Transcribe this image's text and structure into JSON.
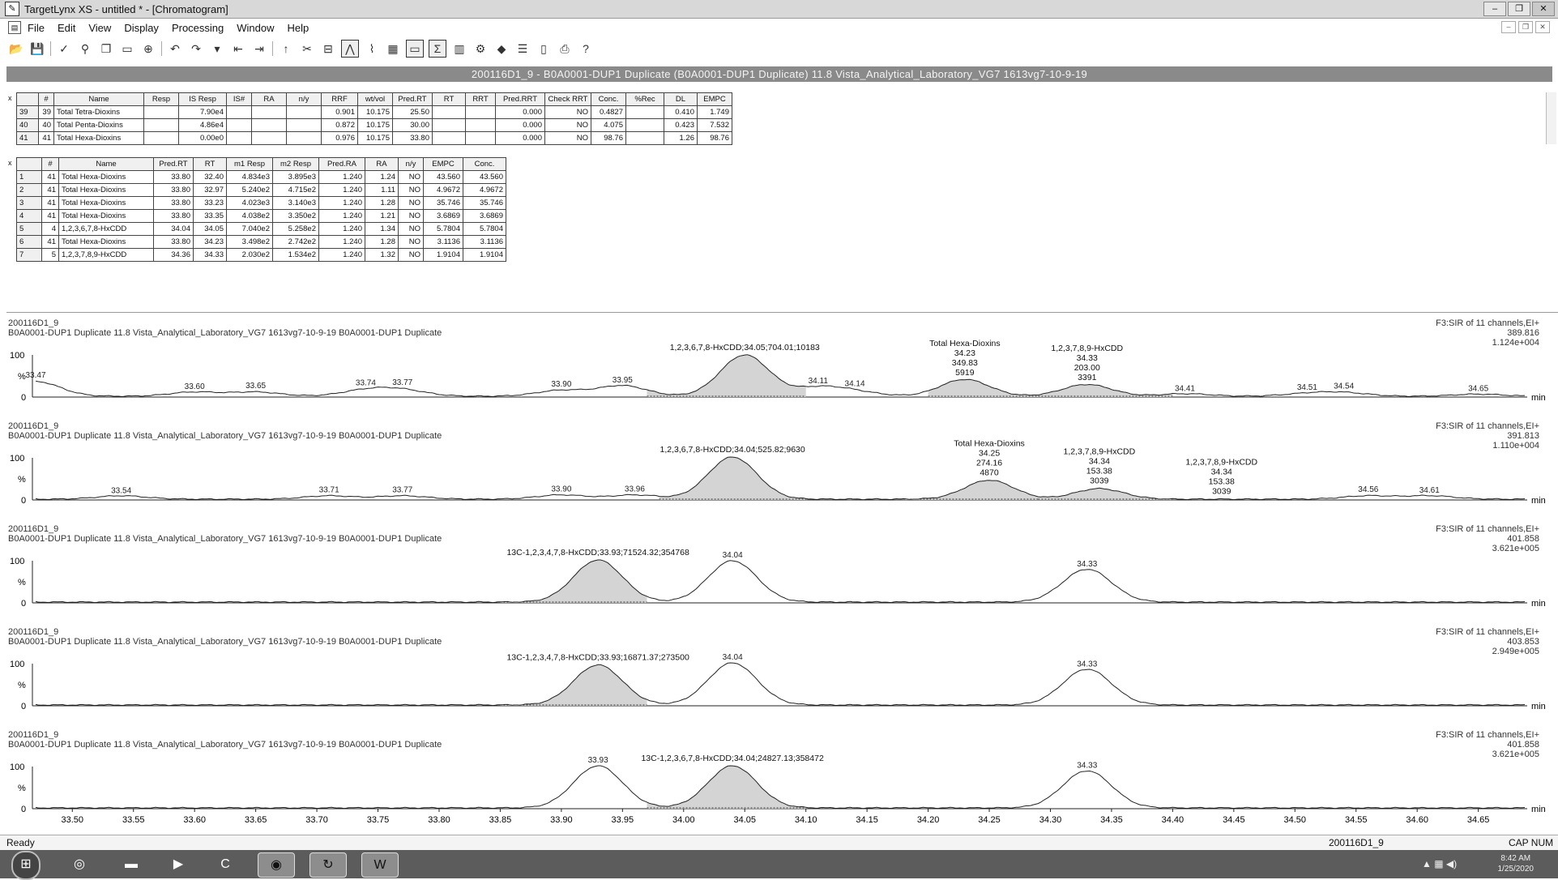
{
  "window": {
    "title": "TargetLynx XS - untitled * - [Chromatogram]"
  },
  "menu": [
    "File",
    "Edit",
    "View",
    "Display",
    "Processing",
    "Window",
    "Help"
  ],
  "databar": "200116D1_9 - B0A0001-DUP1 Duplicate (B0A0001-DUP1 Duplicate) 11.8 Vista_Analytical_Laboratory_VG7 1613vg7-10-9-19",
  "table1": {
    "corner": "x",
    "headers": [
      "#",
      "Name",
      "Resp",
      "IS Resp",
      "IS#",
      "RA",
      "n/y",
      "RRF",
      "wt/vol",
      "Pred.RT",
      "RT",
      "RRT",
      "Pred.RRT",
      "Check RRT",
      "Conc.",
      "%Rec",
      "DL",
      "EMPC"
    ],
    "rows": [
      [
        "39",
        "39",
        "Total Tetra-Dioxins",
        "",
        "7.90e4",
        "",
        "",
        "",
        "0.901",
        "10.175",
        "25.50",
        "",
        "",
        "0.000",
        "NO",
        "0.4827",
        "",
        "0.410",
        "1.749"
      ],
      [
        "40",
        "40",
        "Total Penta-Dioxins",
        "",
        "4.86e4",
        "",
        "",
        "",
        "0.872",
        "10.175",
        "30.00",
        "",
        "",
        "0.000",
        "NO",
        "4.075",
        "",
        "0.423",
        "7.532"
      ],
      [
        "41",
        "41",
        "Total Hexa-Dioxins",
        "",
        "0.00e0",
        "",
        "",
        "",
        "0.976",
        "10.175",
        "33.80",
        "",
        "",
        "0.000",
        "NO",
        "98.76",
        "",
        "1.26",
        "98.76"
      ]
    ]
  },
  "table2": {
    "corner": "x",
    "headers": [
      "#",
      "Name",
      "Pred.RT",
      "RT",
      "m1 Resp",
      "m2 Resp",
      "Pred.RA",
      "RA",
      "n/y",
      "EMPC",
      "Conc."
    ],
    "rows": [
      [
        "1",
        "41",
        "Total Hexa-Dioxins",
        "33.80",
        "32.40",
        "4.834e3",
        "3.895e3",
        "1.240",
        "1.24",
        "NO",
        "43.560",
        "43.560"
      ],
      [
        "2",
        "41",
        "Total Hexa-Dioxins",
        "33.80",
        "32.97",
        "5.240e2",
        "4.715e2",
        "1.240",
        "1.11",
        "NO",
        "4.9672",
        "4.9672"
      ],
      [
        "3",
        "41",
        "Total Hexa-Dioxins",
        "33.80",
        "33.23",
        "4.023e3",
        "3.140e3",
        "1.240",
        "1.28",
        "NO",
        "35.746",
        "35.746"
      ],
      [
        "4",
        "41",
        "Total Hexa-Dioxins",
        "33.80",
        "33.35",
        "4.038e2",
        "3.350e2",
        "1.240",
        "1.21",
        "NO",
        "3.6869",
        "3.6869"
      ],
      [
        "5",
        "4",
        "1,2,3,6,7,8-HxCDD",
        "34.04",
        "34.05",
        "7.040e2",
        "5.258e2",
        "1.240",
        "1.34",
        "NO",
        "5.7804",
        "5.7804"
      ],
      [
        "6",
        "41",
        "Total Hexa-Dioxins",
        "33.80",
        "34.23",
        "3.498e2",
        "2.742e2",
        "1.240",
        "1.28",
        "NO",
        "3.1136",
        "3.1136"
      ],
      [
        "7",
        "5",
        "1,2,3,7,8,9-HxCDD",
        "34.36",
        "34.33",
        "2.030e2",
        "1.534e2",
        "1.240",
        "1.32",
        "NO",
        "1.9104",
        "1.9104"
      ]
    ]
  },
  "panels": [
    {
      "sample": "200116D1_9",
      "desc": "B0A0001-DUP1 Duplicate 11.8 Vista_Analytical_Laboratory_VG7 1613vg7-10-9-19 B0A0001-DUP1 Duplicate",
      "func": "F3:SIR of 11 channels,EI+",
      "mass": "389.816",
      "intensity": "1.124e+004",
      "peaks": [
        [
          33.47,
          0.35
        ],
        [
          33.6,
          0.1
        ],
        [
          33.65,
          0.1
        ],
        [
          33.74,
          0.14
        ],
        [
          33.77,
          0.14
        ],
        [
          33.9,
          0.14
        ],
        [
          33.95,
          0.25
        ],
        [
          34.05,
          0.98
        ],
        [
          34.11,
          0.2
        ],
        [
          34.14,
          0.1
        ],
        [
          34.23,
          0.4
        ],
        [
          34.33,
          0.28
        ],
        [
          34.41,
          0.06
        ],
        [
          34.51,
          0.06
        ],
        [
          34.54,
          0.08
        ],
        [
          34.65,
          0.05
        ]
      ],
      "rt_labels": [
        "33.47",
        "33.60",
        "33.65",
        "33.74",
        "33.77",
        "33.90",
        "33.95",
        "34.11",
        "34.14",
        "34.41",
        "34.51",
        "34.54",
        "34.65"
      ],
      "annotations": [
        {
          "x": 34.05,
          "lines": [
            "1,2,3,6,7,8-HxCDD;34.05;704.01;10183"
          ]
        },
        {
          "x": 34.23,
          "lines": [
            "Total Hexa-Dioxins",
            "34.23",
            "349.83",
            "5919"
          ]
        },
        {
          "x": 34.33,
          "lines": [
            "1,2,3,7,8,9-HxCDD",
            "34.33",
            "203.00",
            "3391"
          ]
        }
      ],
      "shaded": [
        [
          33.97,
          34.1
        ],
        [
          34.2,
          34.29
        ],
        [
          34.29,
          34.4
        ]
      ]
    },
    {
      "sample": "200116D1_9",
      "desc": "B0A0001-DUP1 Duplicate 11.8 Vista_Analytical_Laboratory_VG7 1613vg7-10-9-19 B0A0001-DUP1 Duplicate",
      "func": "F3:SIR of 11 channels,EI+",
      "mass": "391.813",
      "intensity": "1.110e+004",
      "peaks": [
        [
          33.54,
          0.08
        ],
        [
          33.71,
          0.08
        ],
        [
          33.77,
          0.08
        ],
        [
          33.9,
          0.1
        ],
        [
          33.96,
          0.1
        ],
        [
          34.04,
          1.0
        ],
        [
          34.25,
          0.45
        ],
        [
          34.34,
          0.25
        ],
        [
          34.56,
          0.08
        ],
        [
          34.61,
          0.08
        ]
      ],
      "rt_labels": [
        "33.54",
        "33.71",
        "33.77",
        "33.90",
        "33.96",
        "34.56",
        "34.61"
      ],
      "annotations": [
        {
          "x": 34.04,
          "lines": [
            "1,2,3,6,7,8-HxCDD;34.04;525.82;9630"
          ]
        },
        {
          "x": 34.25,
          "lines": [
            "Total Hexa-Dioxins",
            "34.25",
            "274.16",
            "4870"
          ]
        },
        {
          "x": 34.34,
          "lines": [
            "1,2,3,7,8,9-HxCDD",
            "34.34",
            "153.38",
            "3039"
          ]
        },
        {
          "x": 34.44,
          "lines": [
            "1,2,3,7,8,9-HxCDD",
            "34.34",
            "153.38",
            "3039"
          ]
        }
      ],
      "shaded": [
        [
          33.98,
          34.1
        ],
        [
          34.18,
          34.29
        ],
        [
          34.29,
          34.4
        ]
      ]
    },
    {
      "sample": "200116D1_9",
      "desc": "B0A0001-DUP1 Duplicate 11.8 Vista_Analytical_Laboratory_VG7 1613vg7-10-9-19 B0A0001-DUP1 Duplicate",
      "func": "F3:SIR of 11 channels,EI+",
      "mass": "401.858",
      "intensity": "3.621e+005",
      "peaks": [
        [
          33.93,
          1.0
        ],
        [
          34.04,
          0.98
        ],
        [
          34.33,
          0.78
        ]
      ],
      "rt_labels": [
        "34.04",
        "34.33"
      ],
      "annotations": [
        {
          "x": 33.93,
          "lines": [
            "13C-1,2,3,4,7,8-HxCDD;33.93;71524.32;354768"
          ]
        }
      ],
      "shaded": [
        [
          33.85,
          33.97
        ]
      ]
    },
    {
      "sample": "200116D1_9",
      "desc": "B0A0001-DUP1 Duplicate 11.8 Vista_Analytical_Laboratory_VG7 1613vg7-10-9-19 B0A0001-DUP1 Duplicate",
      "func": "F3:SIR of 11 channels,EI+",
      "mass": "403.853",
      "intensity": "2.949e+005",
      "peaks": [
        [
          33.93,
          0.95
        ],
        [
          34.04,
          1.0
        ],
        [
          34.33,
          0.85
        ]
      ],
      "rt_labels": [
        "34.04",
        "34.33"
      ],
      "annotations": [
        {
          "x": 33.93,
          "lines": [
            "13C-1,2,3,4,7,8-HxCDD;33.93;16871.37;273500"
          ]
        }
      ],
      "shaded": [
        [
          33.85,
          33.97
        ]
      ]
    },
    {
      "sample": "200116D1_9",
      "desc": "B0A0001-DUP1 Duplicate 11.8 Vista_Analytical_Laboratory_VG7 1613vg7-10-9-19 B0A0001-DUP1 Duplicate",
      "func": "F3:SIR of 11 channels,EI+",
      "mass": "401.858",
      "intensity": "3.621e+005",
      "peaks": [
        [
          33.93,
          1.0
        ],
        [
          34.04,
          1.0
        ],
        [
          34.33,
          0.88
        ]
      ],
      "rt_labels": [
        "33.93",
        "34.33"
      ],
      "annotations": [
        {
          "x": 34.04,
          "lines": [
            "13C-1,2,3,6,7,8-HxCDD;34.04;24827.13;358472"
          ]
        }
      ],
      "shaded": [
        [
          33.97,
          34.1
        ]
      ]
    }
  ],
  "axis": {
    "ticks": [
      "33.50",
      "33.55",
      "33.60",
      "33.65",
      "33.70",
      "33.75",
      "33.80",
      "33.85",
      "33.90",
      "33.95",
      "34.00",
      "34.05",
      "34.10",
      "34.15",
      "34.20",
      "34.25",
      "34.30",
      "34.35",
      "34.40",
      "34.45",
      "34.50",
      "34.55",
      "34.60",
      "34.65"
    ],
    "unit": "min",
    "y_top": "100",
    "y_mid": "%",
    "y_zero": "0"
  },
  "status": {
    "text": "Ready",
    "file": "200116D1_9",
    "keys": "CAP  NUM"
  },
  "taskbar": {
    "clock_time": "8:42 AM",
    "clock_date": "1/25/2020"
  }
}
